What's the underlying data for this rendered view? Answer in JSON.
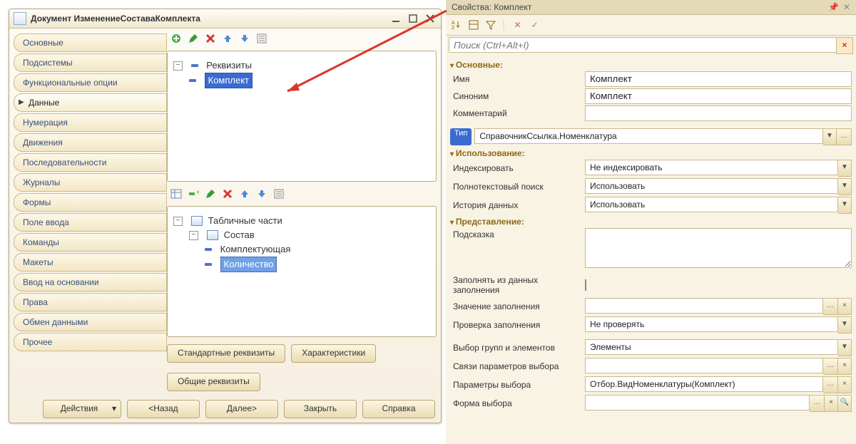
{
  "window": {
    "title": "Документ ИзменениеСоставаКомплекта"
  },
  "tabs": [
    "Основные",
    "Подсистемы",
    "Функциональные опции",
    "Данные",
    "Нумерация",
    "Движения",
    "Последовательности",
    "Журналы",
    "Формы",
    "Поле ввода",
    "Команды",
    "Макеты",
    "Ввод на основании",
    "Права",
    "Обмен данными",
    "Прочее"
  ],
  "active_tab": "Данные",
  "attributes": {
    "root": "Реквизиты",
    "items": [
      "Комплект"
    ]
  },
  "tab_parts": {
    "root": "Табличные части",
    "part": "Состав",
    "fields": [
      "Комплектующая",
      "Количество"
    ]
  },
  "buttons": {
    "standard": "Стандартные реквизиты",
    "characteristics": "Характеристики",
    "common": "Общие реквизиты",
    "actions": "Действия",
    "back": "<Назад",
    "next": "Далее>",
    "close": "Закрыть",
    "help": "Справка"
  },
  "properties": {
    "title": "Свойства: Комплект",
    "search_placeholder": "Поиск (Ctrl+Alt+I)",
    "sections": {
      "main": "Основные:",
      "usage": "Использование:",
      "presentation": "Представление:"
    },
    "main": {
      "name_label": "Имя",
      "name": "Комплект",
      "synonym_label": "Синоним",
      "synonym": "Комплект",
      "comment_label": "Комментарий",
      "comment": "",
      "type_label": "Тип",
      "type": "СправочникСсылка.Номенклатура"
    },
    "usage": {
      "index_label": "Индексировать",
      "index": "Не индексировать",
      "fulltext_label": "Полнотекстовый поиск",
      "fulltext": "Использовать",
      "history_label": "История данных",
      "history": "Использовать"
    },
    "presentation": {
      "hint_label": "Подсказка",
      "hint": "",
      "fillfromdata_label": "Заполнять из данных заполнения",
      "fillvalue_label": "Значение заполнения",
      "fillvalue": "",
      "fillcheck_label": "Проверка заполнения",
      "fillcheck": "Не проверять",
      "groupel_label": "Выбор групп и элементов",
      "groupel": "Элементы",
      "paramlinks_label": "Связи параметров выбора",
      "paramlinks": "",
      "params_label": "Параметры выбора",
      "params": "Отбор.ВидНоменклатуры(Комплект)",
      "form_label": "Форма выбора",
      "form": ""
    }
  }
}
